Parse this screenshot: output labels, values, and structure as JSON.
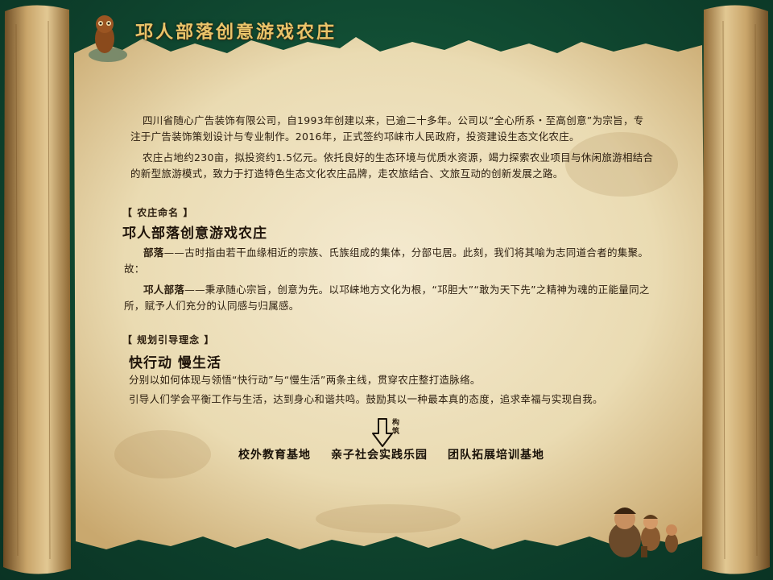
{
  "header": {
    "title": "邛人部落创意游戏农庄"
  },
  "intro": {
    "p1": "四川省随心广告装饰有限公司，自1993年创建以来，已逾二十多年。公司以“全心所系・至高创意”为宗旨，专注于广告装饰策划设计与专业制作。2016年，正式签约邛崃市人民政府，投资建设生态文化农庄。",
    "p2": "农庄占地约230亩，拟投资约1.5亿元。依托良好的生态环境与优质水资源，竭力探索农业项目与休闲旅游相结合的新型旅游模式，致力于打造特色生态文化农庄品牌，走农旅结合、文旅互动的创新发展之路。"
  },
  "naming": {
    "tag": "【 农庄命名 】",
    "heading": "邛人部落创意游戏农庄",
    "term1": "部落",
    "def1": "——古时指由若干血缘相近的宗族、氏族组成的集体，分部屯居。此刻，我们将其喻为志同道合者的集聚。故：",
    "term2": "邛人部落",
    "def2": "——秉承随心宗旨，创意为先。以邛崃地方文化为根，“邛胆大”“敢为天下先”之精神为魂的正能量同之所，赋予人们充分的认同感与归属感。"
  },
  "planning": {
    "tag": "【 规划引导理念 】",
    "heading": "快行动 慢生活",
    "p1": "分别以如何体现与领悟“快行动”与“慢生活”两条主线，贯穿农庄整打造脉络。",
    "p2": "引导人们学会平衡工作与生活，达到身心和谐共鸣。鼓励其以一种最本真的态度，追求幸福与实现自我。"
  },
  "construct": {
    "label": "构筑"
  },
  "bases": [
    "校外教育基地",
    "亲子社会实践乐园",
    "团队拓展培训基地"
  ],
  "colors": {
    "background": "#0f4a34",
    "title": "#e9c46a",
    "parchment": "#eee0bb",
    "text": "#2b1d0e"
  }
}
